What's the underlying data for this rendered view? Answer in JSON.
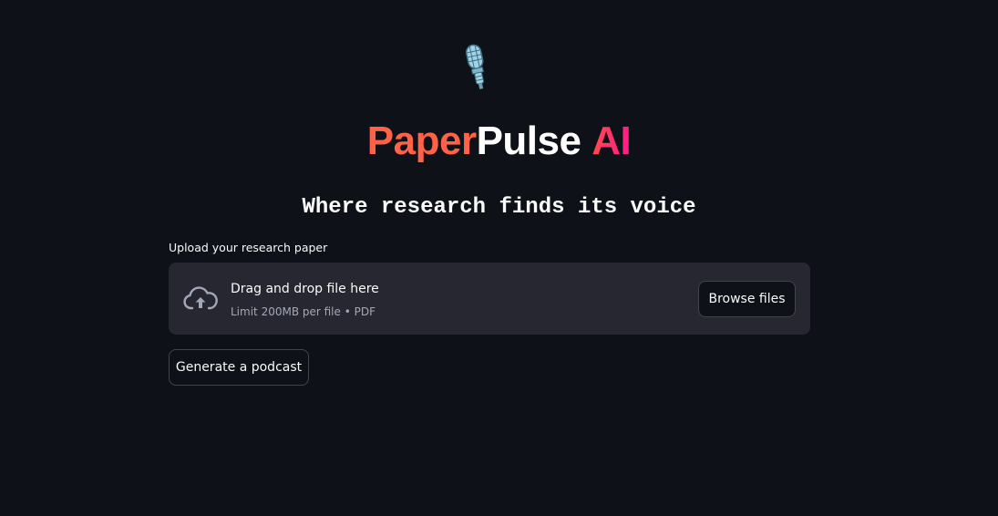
{
  "header": {
    "icon": "microphone-icon",
    "title_part1": "Paper",
    "title_part2": "Pulse",
    "title_part3": "AI",
    "subtitle": "Where research finds its voice"
  },
  "uploader": {
    "label": "Upload your research paper",
    "icon": "cloud-upload-icon",
    "drop_text": "Drag and drop file here",
    "limit_text": "Limit 200MB per file • PDF",
    "browse_label": "Browse files"
  },
  "actions": {
    "generate_label": "Generate a podcast"
  },
  "colors": {
    "background": "#0e1117",
    "dropzone": "#262730",
    "title_paper": "#ff6247",
    "title_pulse": "#ffffff",
    "title_ai": "#ff2a6d"
  }
}
